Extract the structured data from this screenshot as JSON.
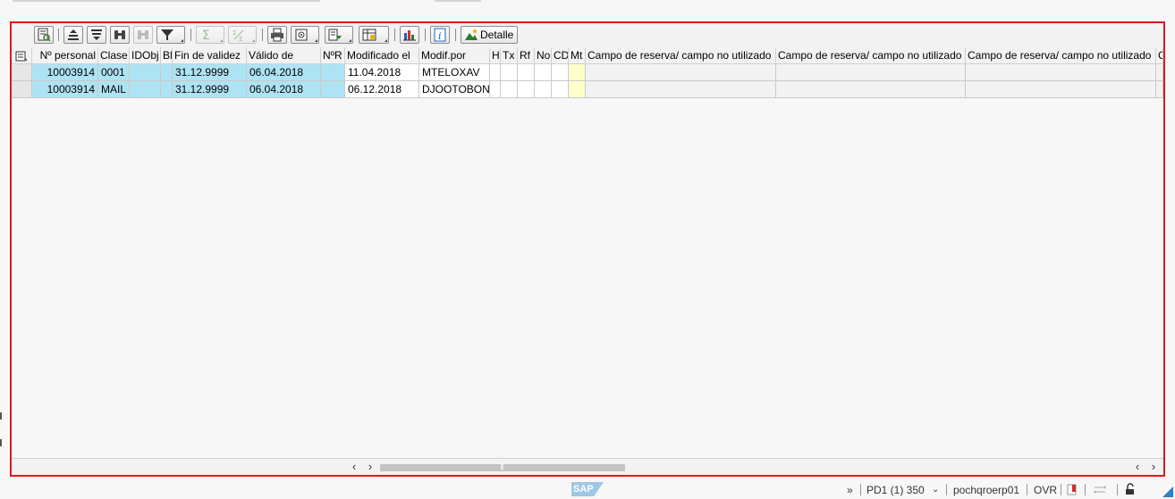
{
  "toolbar": {
    "buttons": [
      {
        "name": "details-icon",
        "icon": "details-icon"
      },
      {
        "name": "sort-ascending-icon",
        "icon": "sort-ascending-icon"
      },
      {
        "name": "sort-descending-icon",
        "icon": "sort-descending-icon"
      },
      {
        "name": "find-icon",
        "icon": "binoculars-icon"
      },
      {
        "name": "find-next-icon",
        "icon": "binoculars-icon"
      },
      {
        "name": "filter-icon",
        "icon": "filter-icon"
      },
      {
        "name": "total-icon",
        "icon": "sigma-icon"
      },
      {
        "name": "subtotal-icon",
        "icon": "subtotal-icon"
      },
      {
        "name": "print-icon",
        "icon": "printer-icon"
      },
      {
        "name": "view-icon",
        "icon": "view-icon"
      },
      {
        "name": "export-icon",
        "icon": "export-icon"
      },
      {
        "name": "layout-icon",
        "icon": "layout-icon"
      },
      {
        "name": "chart-icon",
        "icon": "bar-chart-icon"
      },
      {
        "name": "info-icon",
        "icon": "info-icon"
      }
    ],
    "detalle_label": "Detalle"
  },
  "table": {
    "columns": [
      "Nº personal",
      "Clase",
      "IDObj",
      "Bl",
      "Fin de validez",
      "Válido de",
      "NºR",
      "Modificado el",
      "Modif.por",
      "H",
      "Tx",
      "Rf",
      "No",
      "CD",
      "Mt",
      "Campo de reserva/ campo no utilizado",
      "Campo de reserva/ campo no utilizado",
      "Campo de reserva/ campo no utilizado",
      "C"
    ],
    "rows": [
      [
        "10003914",
        "0001",
        "",
        "",
        "31.12.9999",
        "06.04.2018",
        "",
        "11.04.2018",
        "MTELOXAV",
        "",
        "",
        "",
        "",
        "",
        "",
        "",
        "",
        "",
        ""
      ],
      [
        "10003914",
        "MAIL",
        "",
        "",
        "31.12.9999",
        "06.04.2018",
        "",
        "06.12.2018",
        "DJOOTOBON",
        "",
        "",
        "",
        "",
        "",
        "",
        "",
        "",
        "",
        ""
      ]
    ]
  },
  "statusbar": {
    "expand": "»",
    "system": "PD1 (1) 350",
    "server": "pochqroerp01",
    "mode": "OVR",
    "logo": "SAP"
  },
  "colors": {
    "frame_border": "#e0161b",
    "key_cell": "#aee3f3",
    "highlight_cell": "#ffffcc",
    "accent": "#2a82c7"
  }
}
